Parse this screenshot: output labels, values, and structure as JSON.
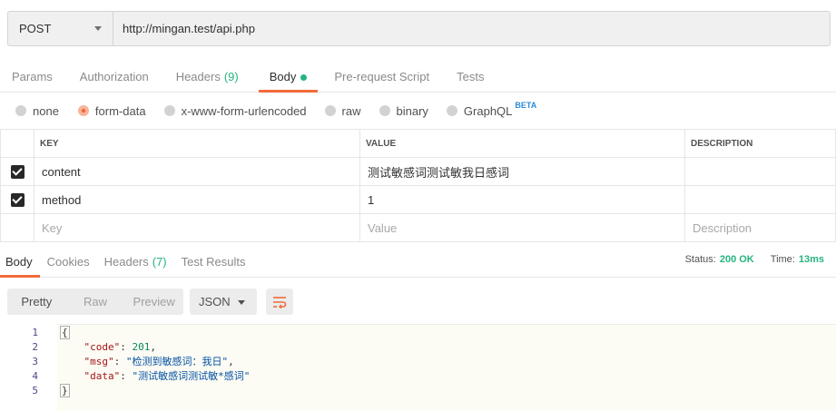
{
  "request": {
    "method": "POST",
    "url": "http://mingan.test/api.php"
  },
  "request_tabs": [
    {
      "label": "Params",
      "count": ""
    },
    {
      "label": "Authorization",
      "count": ""
    },
    {
      "label": "Headers",
      "count": "(9)"
    },
    {
      "label": "Body",
      "count": ""
    },
    {
      "label": "Pre-request Script",
      "count": ""
    },
    {
      "label": "Tests",
      "count": ""
    }
  ],
  "body_types": [
    {
      "label": "none"
    },
    {
      "label": "form-data"
    },
    {
      "label": "x-www-form-urlencoded"
    },
    {
      "label": "raw"
    },
    {
      "label": "binary"
    },
    {
      "label": "GraphQL",
      "badge": "BETA"
    }
  ],
  "params_table": {
    "headers": [
      "KEY",
      "VALUE",
      "DESCRIPTION"
    ],
    "rows": [
      {
        "key": "content",
        "value": "测试敏感词测试敏我日感词",
        "description": ""
      },
      {
        "key": "method",
        "value": "1",
        "description": ""
      }
    ],
    "placeholders": {
      "key": "Key",
      "value": "Value",
      "description": "Description"
    }
  },
  "response_tabs": [
    {
      "label": "Body",
      "count": ""
    },
    {
      "label": "Cookies",
      "count": ""
    },
    {
      "label": "Headers",
      "count": "(7)"
    },
    {
      "label": "Test Results",
      "count": ""
    }
  ],
  "status": {
    "status_label": "Status:",
    "status_value": "200 OK",
    "time_label": "Time:",
    "time_value": "13ms"
  },
  "response_view": {
    "modes": [
      "Pretty",
      "Raw",
      "Preview"
    ],
    "format": "JSON"
  },
  "code": {
    "line_numbers": [
      "1",
      "2",
      "3",
      "4",
      "5"
    ],
    "open_brace": "{",
    "close_brace": "}",
    "entries": [
      {
        "key": "\"code\"",
        "value": "201",
        "trail": ","
      },
      {
        "key": "\"msg\"",
        "value": "\"检测到敏感词：我日\"",
        "trail": ","
      },
      {
        "key": "\"data\"",
        "value": "\"测试敏感词测试敏*感词\"",
        "trail": ""
      }
    ]
  },
  "colors": {
    "accent": "#f26b3a",
    "success": "#26b47f"
  }
}
